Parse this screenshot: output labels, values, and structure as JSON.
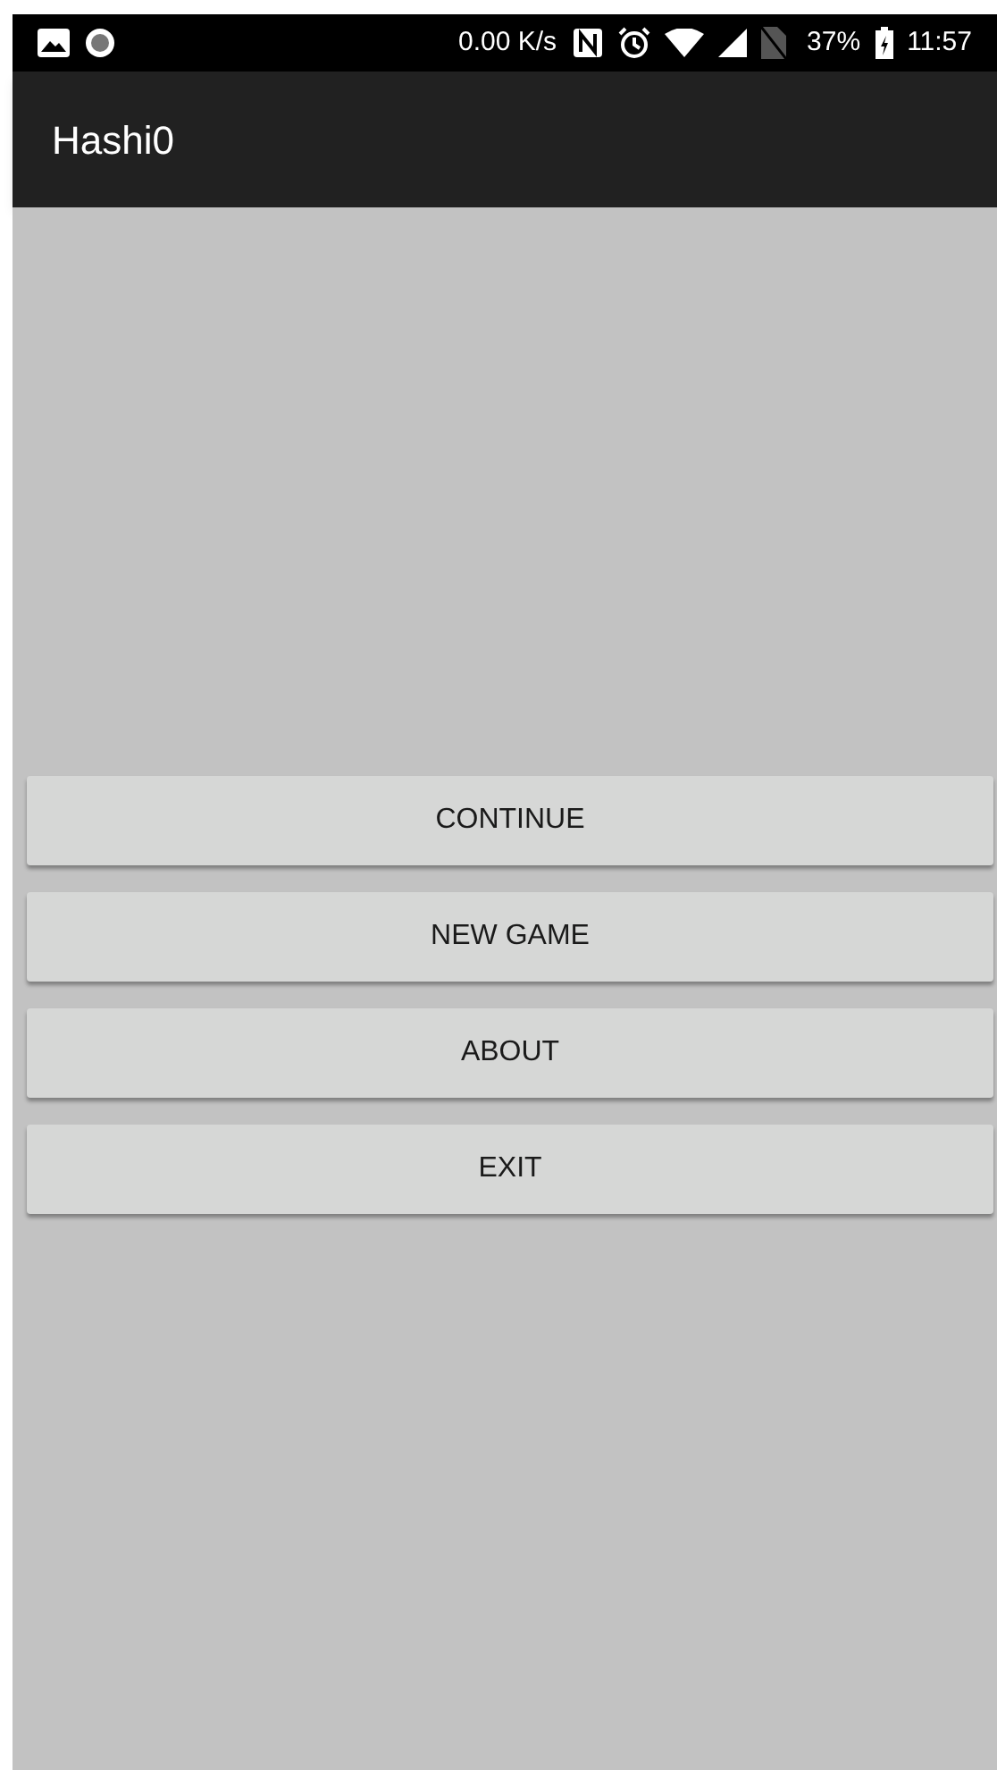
{
  "status_bar": {
    "network_speed": "0.00 K/s",
    "battery": "37%",
    "time": "11:57"
  },
  "app_bar": {
    "title": "Hashi0"
  },
  "menu_buttons": [
    {
      "label": "CONTINUE"
    },
    {
      "label": "NEW GAME"
    },
    {
      "label": "ABOUT"
    },
    {
      "label": "EXIT"
    }
  ]
}
